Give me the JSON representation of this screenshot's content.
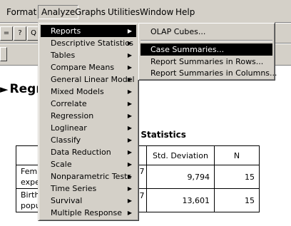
{
  "menubar": {
    "items": [
      "Format",
      "Analyze",
      "Graphs",
      "Utilities",
      "Window",
      "Help"
    ]
  },
  "analyze_menu": {
    "items": [
      "Reports",
      "Descriptive Statistics",
      "Tables",
      "Compare Means",
      "General Linear Model",
      "Mixed Models",
      "Correlate",
      "Regression",
      "Loglinear",
      "Classify",
      "Data Reduction",
      "Scale",
      "Nonparametric Tests",
      "Time Series",
      "Survival",
      "Multiple Response"
    ]
  },
  "reports_menu": {
    "items": [
      "OLAP Cubes...",
      "Case Summaries...",
      "Report Summaries in Rows...",
      "Report Summaries in Columns..."
    ]
  },
  "viewer": {
    "outline_title": "Regr",
    "desc_title": "e Statistics",
    "table": {
      "headers": [
        "",
        "Std. Deviation",
        "N"
      ],
      "rows": [
        {
          "label1": "Fem",
          "label2": "expe",
          "mean_frag": "7",
          "sd": "9,794",
          "n": "15"
        },
        {
          "label1": "Birth",
          "label2": "popu",
          "mean_frag": "7",
          "sd": "13,601",
          "n": "15"
        }
      ]
    }
  },
  "toolbar": {
    "btn1": "=",
    "btn2": "?",
    "btn3": "Q"
  }
}
